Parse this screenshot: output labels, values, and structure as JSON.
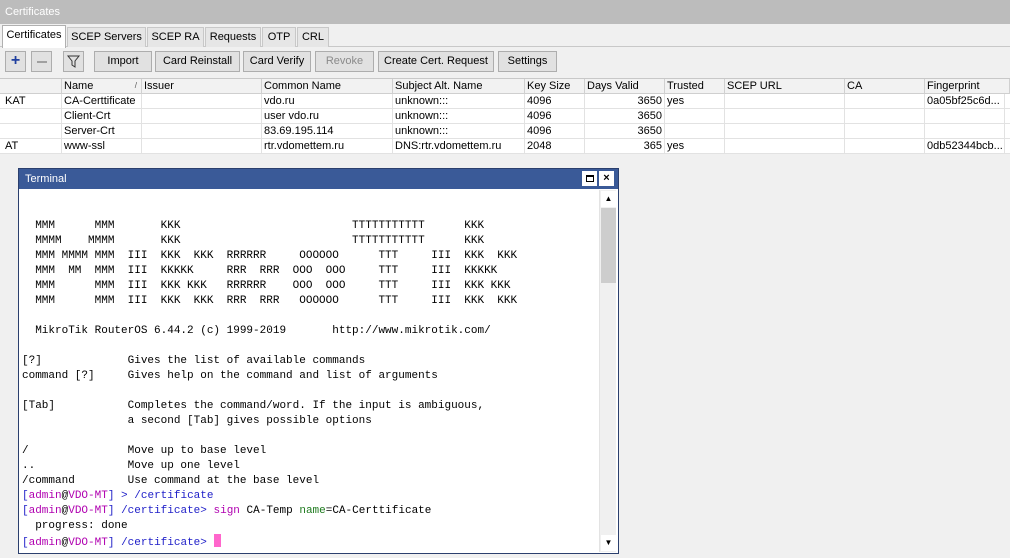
{
  "window": {
    "title": "Certificates"
  },
  "tabs": [
    {
      "label": "Certificates"
    },
    {
      "label": "SCEP Servers"
    },
    {
      "label": "SCEP RA"
    },
    {
      "label": "Requests"
    },
    {
      "label": "OTP"
    },
    {
      "label": "CRL"
    }
  ],
  "toolbar": {
    "add_symbol": "+",
    "import": "Import",
    "card_reinstall": "Card Reinstall",
    "card_verify": "Card Verify",
    "revoke": "Revoke",
    "create_request": "Create Cert. Request",
    "settings": "Settings"
  },
  "table": {
    "sort_indicator": "/",
    "columns": [
      "",
      "Name",
      "Issuer",
      "Common Name",
      "Subject Alt. Name",
      "Key Size",
      "Days Valid",
      "Trusted",
      "SCEP URL",
      "CA",
      "Fingerprint"
    ],
    "rows": [
      [
        "KAT",
        "CA-Certtificate",
        "",
        "vdo.ru",
        "unknown:::",
        "4096",
        "3650",
        "yes",
        "",
        "",
        "0a05bf25c6d..."
      ],
      [
        "",
        "Client-Crt",
        "",
        "user vdo.ru",
        "unknown:::",
        "4096",
        "3650",
        "",
        "",
        "",
        ""
      ],
      [
        "",
        "Server-Crt",
        "",
        "83.69.195.114",
        "unknown:::",
        "4096",
        "3650",
        "",
        "",
        "",
        ""
      ],
      [
        "AT",
        "www-ssl",
        "",
        "rtr.vdomettem.ru",
        "DNS:rtr.vdomettem.ru",
        "2048",
        "365",
        "yes",
        "",
        "",
        "0db52344bcb..."
      ]
    ]
  },
  "terminal": {
    "title": "Terminal",
    "banner": [
      "",
      "",
      "  MMM      MMM       KKK                          TTTTTTTTTTT      KKK",
      "  MMMM    MMMM       KKK                          TTTTTTTTTTT      KKK",
      "  MMM MMMM MMM  III  KKK  KKK  RRRRRR     OOOOOO      TTT     III  KKK  KKK",
      "  MMM  MM  MMM  III  KKKKK     RRR  RRR  OOO  OOO     TTT     III  KKKKK",
      "  MMM      MMM  III  KKK KKK   RRRRRR    OOO  OOO     TTT     III  KKK KKK",
      "  MMM      MMM  III  KKK  KKK  RRR  RRR   OOOOOO      TTT     III  KKK  KKK",
      "",
      "  MikroTik RouterOS 6.44.2 (c) 1999-2019       http://www.mikrotik.com/",
      "",
      "[?]             Gives the list of available commands",
      "command [?]     Gives help on the command and list of arguments",
      "",
      "[Tab]           Completes the command/word. If the input is ambiguous,",
      "                a second [Tab] gives possible options",
      "",
      "/               Move up to base level",
      "..              Move up one level",
      "/command        Use command at the base level"
    ],
    "prompt": {
      "open": "[",
      "user": "admin",
      "at": "@",
      "host": "VDO-MT",
      "close": "]",
      "sep": " > ",
      "path": "/certificate",
      "path_end": ">"
    },
    "cmd1": "/certificate",
    "cmd2_sign": "sign",
    "cmd2_arg": "CA-Temp",
    "cmd2_key": "name",
    "cmd2_eq": "=",
    "cmd2_val": "CA-Certtificate",
    "progress": "  progress: done"
  },
  "colors": {
    "terminal_title_bg": "#3a5a98",
    "prompt_blue": "#1e1ec8",
    "prompt_magenta": "#b000b0",
    "cursor": "#ff66cc"
  }
}
